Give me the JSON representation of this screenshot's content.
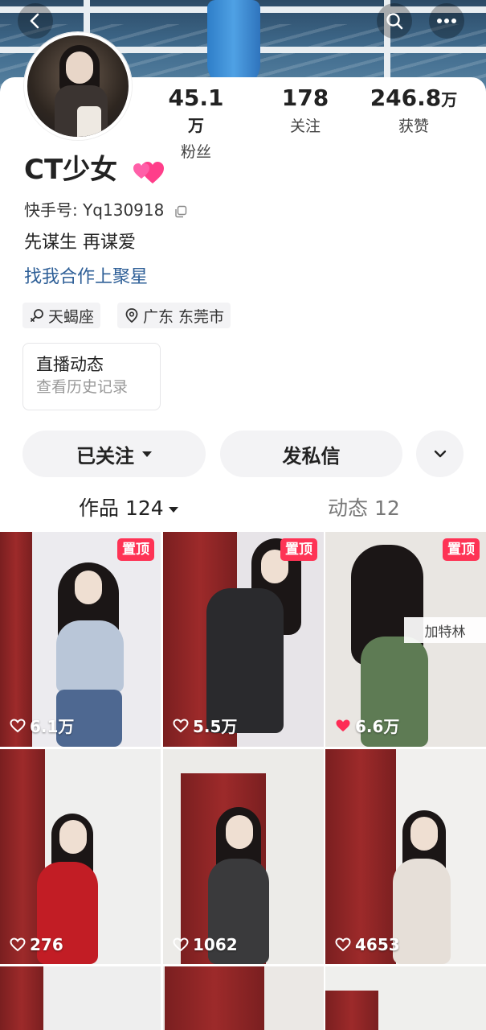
{
  "cover": {},
  "topbar": {
    "back_icon": "chevron-left-icon",
    "search_icon": "search-icon",
    "more_icon": "more-dots-icon"
  },
  "profile": {
    "stats": [
      {
        "value": "45.1",
        "unit": "万",
        "label": "粉丝"
      },
      {
        "value": "178",
        "unit": "",
        "label": "关注"
      },
      {
        "value": "246.8",
        "unit": "万",
        "label": "获赞"
      }
    ],
    "name": "CT少女",
    "name_emoji": "heart-emoji",
    "uid_label": "快手号: Yq130918",
    "bio": "先谋生 再谋爱",
    "link": "找我合作上聚星",
    "tags": [
      {
        "icon": "zodiac-icon",
        "text": "天蝎座"
      },
      {
        "icon": "location-icon",
        "text": "广东 东莞市"
      }
    ],
    "live_card": {
      "title": "直播动态",
      "subtitle": "查看历史记录"
    }
  },
  "actions": {
    "follow_label": "已关注",
    "message_label": "发私信",
    "expand_icon": "chevron-down-icon"
  },
  "tabs": [
    {
      "label": "作品 124"
    },
    {
      "label": "动态 12"
    }
  ],
  "videos": [
    {
      "pinned": "置顶",
      "likes": "6.1万",
      "liked": false
    },
    {
      "pinned": "置顶",
      "likes": "5.5万",
      "liked": false
    },
    {
      "pinned": "置顶",
      "likes": "6.6万",
      "liked": true,
      "sticker": "加特林"
    },
    {
      "pinned": "",
      "likes": "276",
      "liked": false
    },
    {
      "pinned": "",
      "likes": "1062",
      "liked": false
    },
    {
      "pinned": "",
      "likes": "4653",
      "liked": false
    }
  ],
  "colors": {
    "pin_badge": "#fe3355",
    "link": "#2e5f97",
    "liked_heart": "#fe2c55"
  }
}
